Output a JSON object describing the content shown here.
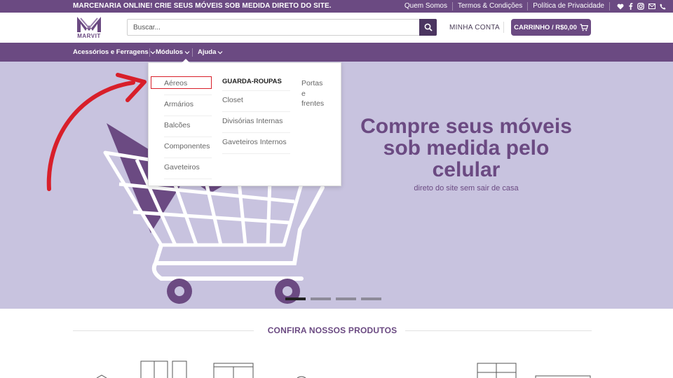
{
  "topbar": {
    "promo": "MARCENARIA ONLINE! CRIE SEUS MÓVEIS SOB MEDIDA DIRETO DO SITE.",
    "links": [
      "Quem Somos",
      "Termos & Condições",
      "Política de Privacidade"
    ],
    "social_icons": [
      "heart-icon",
      "facebook-icon",
      "instagram-icon",
      "mail-icon",
      "phone-icon"
    ]
  },
  "header": {
    "logo_text": "MARVIT",
    "search_placeholder": "Buscar...",
    "account_label": "MINHA CONTA",
    "cart_label": "CARRINHO / R$0,00"
  },
  "nav": {
    "items": [
      "Acessórios e Ferragens",
      "Módulos",
      "Ajuda"
    ]
  },
  "dropdown": {
    "col1": [
      "Aéreos",
      "Armários",
      "Balcões",
      "Componentes",
      "Gaveteiros"
    ],
    "col2_head": "GUARDA-ROUPAS",
    "col2": [
      "Closet",
      "Divisórias Internas",
      "Gaveteiros Internos"
    ],
    "col3_lines": [
      "Portas",
      "e",
      "frentes"
    ],
    "highlighted_item": "Aéreos"
  },
  "hero": {
    "title_lines": [
      "Compre seus móveis",
      "sob medida pelo",
      "celular"
    ],
    "subtitle": "direto do site sem sair de casa",
    "slide_count": 4,
    "active_slide": 1
  },
  "products": {
    "section_title": "CONFIRA NOSSOS PRODUTOS"
  },
  "colors": {
    "brand": "#6b4a82",
    "brand_dark": "#4b3560",
    "hero_bg": "#c8c3df",
    "annotation_red": "#d81f2a"
  }
}
